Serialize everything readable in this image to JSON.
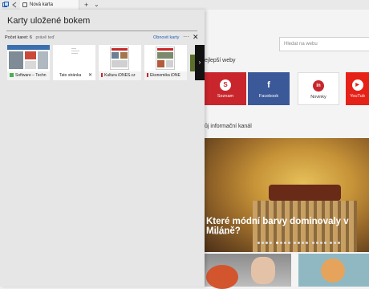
{
  "titlebar": {
    "tab_label": "Nová karta",
    "new_tab_symbol": "+",
    "menu_symbol": "⌄"
  },
  "panel": {
    "title": "Karty uložené bokem",
    "count_label": "Počet karet: 6",
    "time_label": "právě teď",
    "restore_label": "Obnovit karty",
    "more_symbol": "···",
    "close_symbol": "✕",
    "scroll_symbol": "›",
    "cards": [
      {
        "label": "Software – Techn",
        "icon": "leaf-favicon",
        "color": "#4caf50"
      },
      {
        "label": "Tato stránka",
        "icon": "blank-favicon",
        "color": "#bbbbbb"
      },
      {
        "label": "Kultura iDNES.cz",
        "icon": "idnes-favicon",
        "color": "#c62828"
      },
      {
        "label": "Ekonomika iDNE",
        "icon": "idnes-favicon",
        "color": "#c62828"
      }
    ]
  },
  "page": {
    "search_placeholder": "Hledat na webu",
    "top_sites_label": "ejlepší weby",
    "feed_label": "ůj informační kanál",
    "sites": [
      {
        "label": "Seznam",
        "letter": "S",
        "color": "#c8262c"
      },
      {
        "label": "Facebook",
        "letter": "f",
        "color": "#3b5998"
      },
      {
        "label": "Novinky",
        "letter": "in",
        "color": "#ffffff"
      },
      {
        "label": "YouTub",
        "letter": "▶",
        "color": "#e62117"
      }
    ],
    "hero_caption": "Které módní barvy dominovaly v Miláně?",
    "hero_source": "marianne"
  },
  "colors": {
    "accent": "#1a5fb4",
    "panel_bg": "#e6e6e6"
  }
}
